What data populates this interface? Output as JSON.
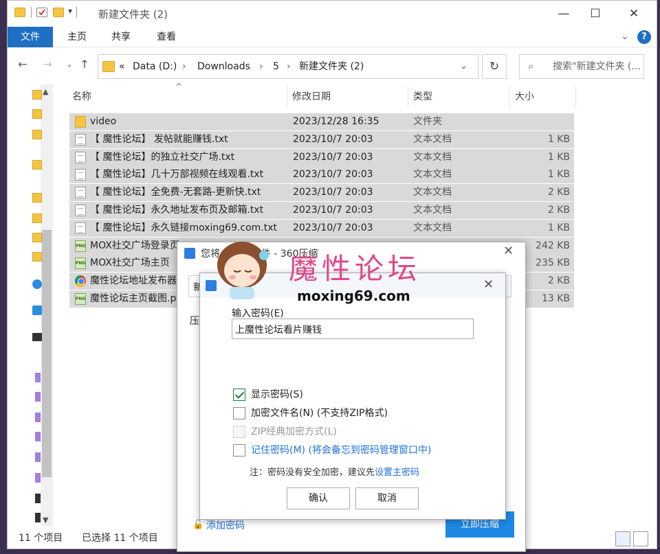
{
  "window": {
    "title": "新建文件夹 (2)",
    "controls": [
      "—",
      "☐",
      "✕"
    ]
  },
  "ribbon": {
    "tabs": [
      "文件",
      "主页",
      "共享",
      "查看"
    ],
    "help": "?"
  },
  "nav": {
    "path": [
      "«",
      "Data (D:)",
      "Downloads",
      "5",
      "新建文件夹 (2)"
    ],
    "search_placeholder": "搜索\"新建文件夹 (..."
  },
  "columns": {
    "name": "名称",
    "date": "修改日期",
    "type": "类型",
    "size": "大小"
  },
  "files": [
    {
      "name": "video",
      "date": "2023/12/28 16:35",
      "type": "文件夹",
      "size": "",
      "icon": "folder"
    },
    {
      "name": "【 魔性论坛】 发帖就能赚钱.txt",
      "date": "2023/10/7 20:03",
      "type": "文本文档",
      "size": "1 KB",
      "icon": "txt"
    },
    {
      "name": "【 魔性论坛】的独立社交广场.txt",
      "date": "2023/10/7 20:03",
      "type": "文本文档",
      "size": "1 KB",
      "icon": "txt"
    },
    {
      "name": "【 魔性论坛】几十万部视频在线观看.txt",
      "date": "2023/10/7 20:03",
      "type": "文本文档",
      "size": "1 KB",
      "icon": "txt"
    },
    {
      "name": "【 魔性论坛】全免费-无套路-更新快.txt",
      "date": "2023/10/7 20:03",
      "type": "文本文档",
      "size": "2 KB",
      "icon": "txt"
    },
    {
      "name": "【 魔性论坛】永久地址发布页及邮箱.txt",
      "date": "2023/10/7 20:03",
      "type": "文本文档",
      "size": "2 KB",
      "icon": "txt"
    },
    {
      "name": "【 魔性论坛】永久链接moxing69.com.txt",
      "date": "2023/10/7 20:03",
      "type": "文本文档",
      "size": "1 KB",
      "icon": "txt"
    },
    {
      "name": "MOX社交广场登录页",
      "date": "",
      "type": "",
      "size": "242 KB",
      "icon": "png"
    },
    {
      "name": "MOX社交广场主页",
      "date": "",
      "type": "",
      "size": "235 KB",
      "icon": "png"
    },
    {
      "name": "魔性论坛地址发布器",
      "date": "",
      "type": "",
      "size": "2 KB",
      "icon": "chrome"
    },
    {
      "name": "魔性论坛主页截图.p",
      "date": "",
      "type": "",
      "size": "13 KB",
      "icon": "png"
    }
  ],
  "status": {
    "count": "11 个项目",
    "selected": "已选择 11 个项目"
  },
  "compress_dialog": {
    "title": "您将... 压缩文件 - 360压缩",
    "name_prefix": "新",
    "compress_prefix": "压",
    "add_password": "添加密码",
    "compress_now": "立即压缩"
  },
  "password_dialog": {
    "label": "输入密码(E)",
    "password_value": "上魔性论坛看片赚钱",
    "show_password": "显示密码(S)",
    "encrypt_names": "加密文件名(N) (不支持ZIP格式)",
    "zip_classic": "ZIP经典加密方式(L)",
    "remember": "记住密码(M) (将会备忘到密码管理窗口中)",
    "note": "注：密码没有安全加密，建议先",
    "note_link": "设置主密码",
    "ok": "确认",
    "cancel": "取消"
  },
  "watermark": {
    "title": "魔性论坛",
    "url": "moxing69.com"
  }
}
